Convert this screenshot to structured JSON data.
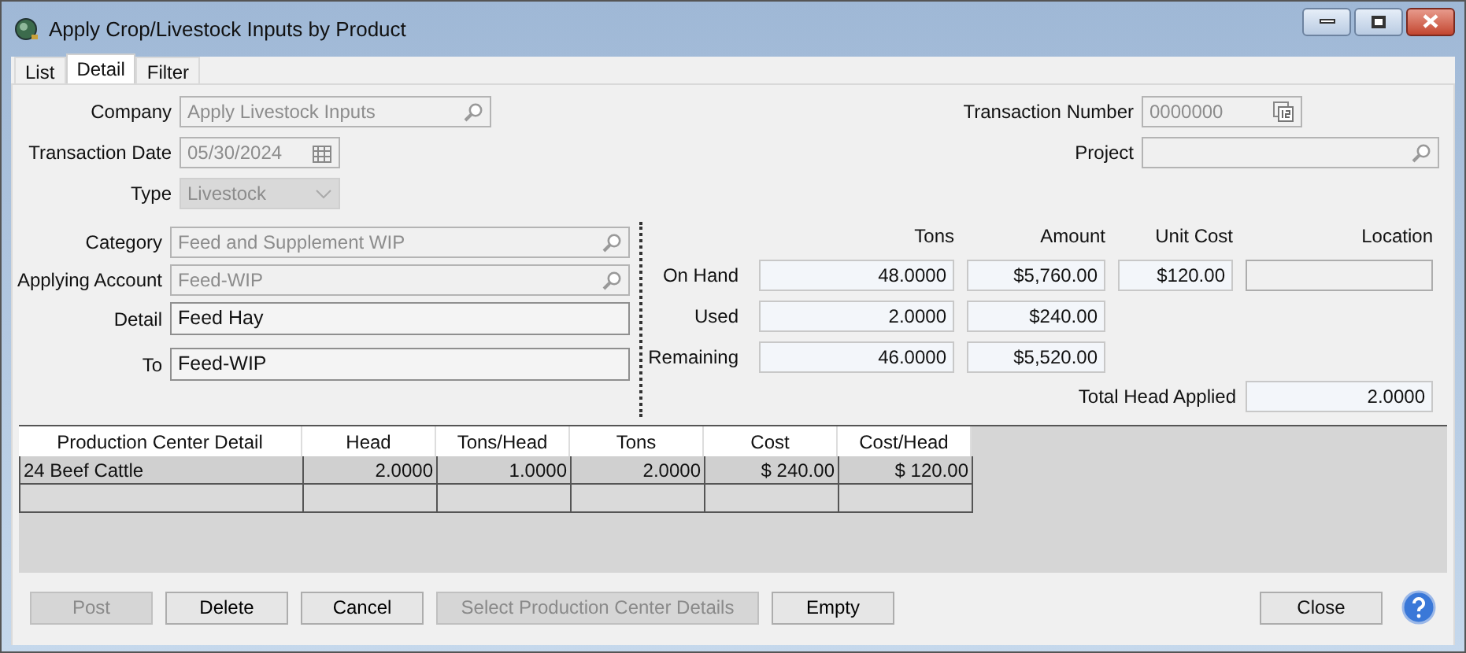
{
  "window": {
    "title": "Apply Crop/Livestock Inputs by Product"
  },
  "tabs": [
    {
      "label": "List",
      "selected": false
    },
    {
      "label": "Detail",
      "selected": true
    },
    {
      "label": "Filter",
      "selected": false
    }
  ],
  "header_left": [
    {
      "label": "Company",
      "value": "Apply Livestock Inputs",
      "kind": "lookup",
      "disabled": true
    },
    {
      "label": "Transaction Date",
      "value": "05/30/2024",
      "kind": "date",
      "disabled": true
    },
    {
      "label": "Type",
      "value": "Livestock",
      "kind": "dropdown",
      "disabled": true
    }
  ],
  "header_right": [
    {
      "label": "Transaction Number",
      "value": "0000000",
      "kind": "number",
      "disabled": true
    },
    {
      "label": "Project",
      "kind": "lookup",
      "disabled": true
    }
  ],
  "product": [
    {
      "label": "Category",
      "value": "Feed and Supplement WIP",
      "kind": "lookup",
      "disabled": true
    },
    {
      "label": "Applying Account",
      "value": "Feed-WIP",
      "kind": "lookup",
      "disabled": true
    },
    {
      "label": "Detail",
      "value": "Feed Hay",
      "kind": "text",
      "disabled": false
    },
    {
      "label": "To",
      "value": "Feed-WIP",
      "kind": "text",
      "disabled": false
    }
  ],
  "quantities": {
    "columns": [
      "Tons",
      "Amount",
      "Unit Cost",
      "Location"
    ],
    "rows": [
      {
        "label": "On Hand",
        "values": [
          "48.0000",
          "$5,760.00",
          "$120.00"
        ],
        "location_box": true
      },
      {
        "label": "Used",
        "values": [
          "2.0000",
          "$240.00"
        ]
      },
      {
        "label": "Remaining",
        "values": [
          "46.0000",
          "$5,520.00"
        ]
      }
    ],
    "total_label": "Total Head Applied",
    "total_value": "2.0000"
  },
  "table": {
    "columns": [
      "Production Center Detail",
      "Head",
      "Tons/Head",
      "Tons",
      "Cost",
      "Cost/Head"
    ],
    "rows": [
      [
        "24 Beef Cattle",
        "2.0000",
        "1.0000",
        "2.0000",
        "$ 240.00",
        "$ 120.00"
      ],
      [
        "",
        "",
        "",
        "",
        "",
        ""
      ]
    ]
  },
  "buttons": [
    {
      "label": "Post",
      "disabled": true
    },
    {
      "label": "Delete",
      "disabled": false
    },
    {
      "label": "Cancel",
      "disabled": false
    },
    {
      "label": "Select Production Center Details",
      "disabled": true
    },
    {
      "label": "Empty",
      "disabled": false
    }
  ],
  "close_button": "Close"
}
